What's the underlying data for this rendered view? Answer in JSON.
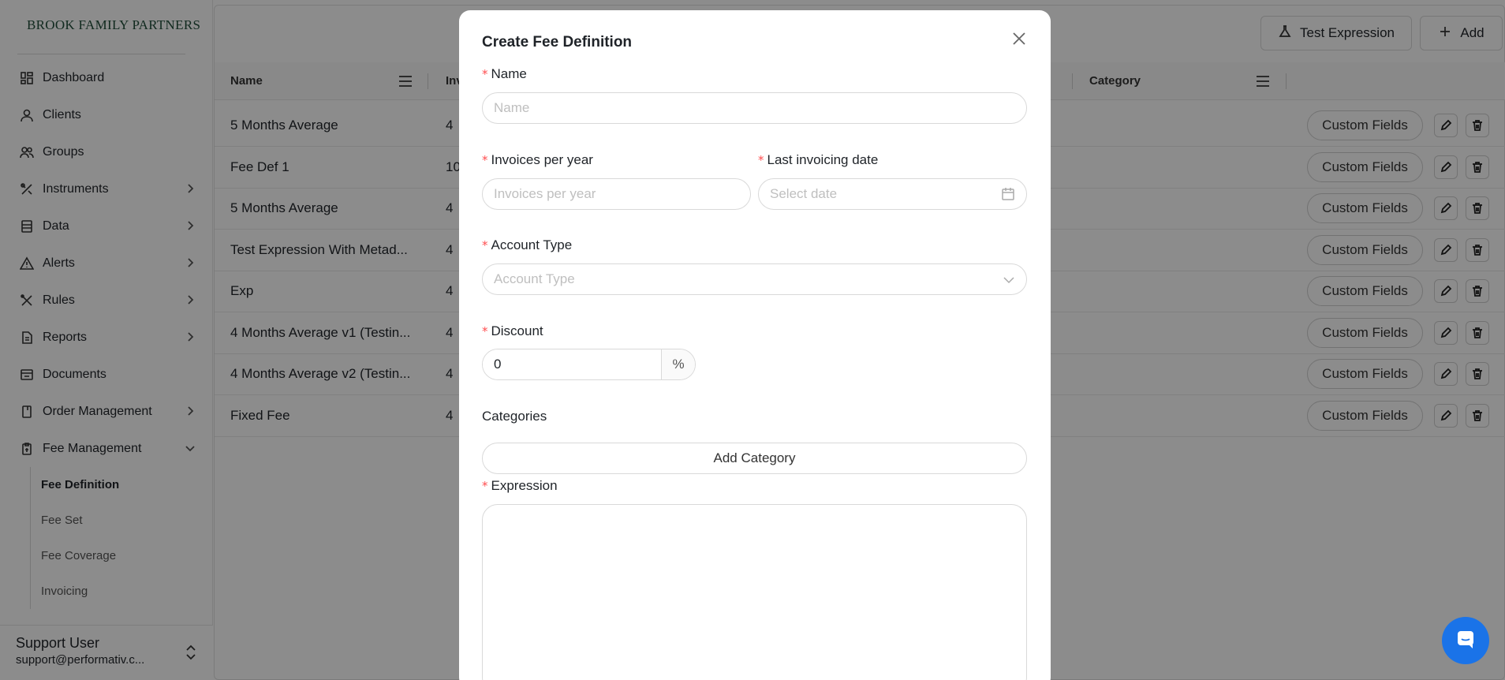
{
  "sidebar": {
    "brand": "BROOK FAMILY PARTNERS",
    "items": [
      {
        "label": "Dashboard",
        "icon": "dashboard-icon",
        "has_chevron": false
      },
      {
        "label": "Clients",
        "icon": "user-icon",
        "has_chevron": false
      },
      {
        "label": "Groups",
        "icon": "group-icon",
        "has_chevron": false
      },
      {
        "label": "Instruments",
        "icon": "instruments-icon",
        "has_chevron": true
      },
      {
        "label": "Data",
        "icon": "database-icon",
        "has_chevron": true
      },
      {
        "label": "Alerts",
        "icon": "alert-icon",
        "has_chevron": true
      },
      {
        "label": "Rules",
        "icon": "rules-icon",
        "has_chevron": true
      },
      {
        "label": "Reports",
        "icon": "report-icon",
        "has_chevron": true
      },
      {
        "label": "Documents",
        "icon": "documents-icon",
        "has_chevron": false
      },
      {
        "label": "Order Management",
        "icon": "order-icon",
        "has_chevron": true
      },
      {
        "label": "Fee Management",
        "icon": "fee-icon",
        "has_chevron": true
      }
    ],
    "sub_items": [
      {
        "label": "Fee Definition",
        "active": true
      },
      {
        "label": "Fee Set",
        "active": false
      },
      {
        "label": "Fee Coverage",
        "active": false
      },
      {
        "label": "Invoicing",
        "active": false
      }
    ],
    "user": {
      "name": "Support User",
      "email": "support@performativ.c..."
    }
  },
  "toolbar": {
    "test_expression_label": "Test Expression",
    "add_label": "Add"
  },
  "table": {
    "headers": {
      "name": "Name",
      "invoices": "Inv",
      "category": "Category"
    },
    "rows": [
      {
        "name": "5 Months Average",
        "invoices": "4",
        "action": "Custom Fields"
      },
      {
        "name": "Fee Def 1",
        "invoices": "10",
        "action": "Custom Fields"
      },
      {
        "name": "5 Months Average",
        "invoices": "4",
        "action": "Custom Fields"
      },
      {
        "name": "Test Expression With Metad...",
        "invoices": "4",
        "action": "Custom Fields"
      },
      {
        "name": "Exp",
        "invoices": "4",
        "action": "Custom Fields"
      },
      {
        "name": "4 Months Average v1 (Testin...",
        "invoices": "4",
        "action": "Custom Fields"
      },
      {
        "name": "4 Months Average v2 (Testin...",
        "invoices": "4",
        "action": "Custom Fields"
      },
      {
        "name": "Fixed Fee",
        "invoices": "4",
        "action": "Custom Fields"
      }
    ]
  },
  "modal": {
    "title": "Create Fee Definition",
    "name_label": "Name",
    "name_placeholder": "Name",
    "invoices_label": "Invoices per year",
    "invoices_placeholder": "Invoices per year",
    "last_date_label": "Last invoicing date",
    "last_date_placeholder": "Select date",
    "account_type_label": "Account Type",
    "account_type_placeholder": "Account Type",
    "discount_label": "Discount",
    "discount_value": "0",
    "discount_suffix": "%",
    "categories_label": "Categories",
    "add_category_label": "Add Category",
    "expression_label": "Expression"
  },
  "colors": {
    "brand": "#1f4d3a",
    "required": "#ff4d4f",
    "chat": "#1a73e8"
  }
}
